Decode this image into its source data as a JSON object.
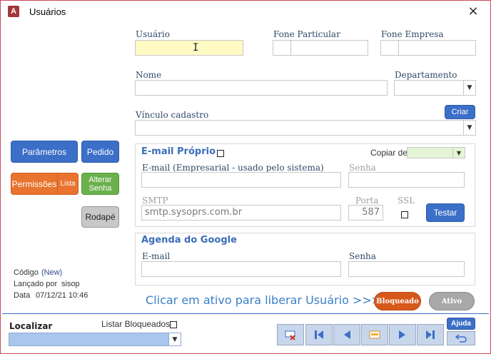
{
  "window": {
    "title": "Usuários",
    "close_icon": "×"
  },
  "fields": {
    "usuario_label": "Usuário",
    "fone_particular_label": "Fone Particular",
    "fone_empresa_label": "Fone Empresa",
    "nome_label": "Nome",
    "departamento_label": "Departamento",
    "vinculo_label": "Vínculo cadastro",
    "criar_label": "Criar"
  },
  "email_proprio": {
    "title": "E-mail Próprio",
    "copiar_de_label": "Copiar de",
    "email_label": "E-mail (Empresarial - usado pelo sistema)",
    "senha_label": "Senha",
    "smtp_label": "SMTP",
    "smtp_value": "smtp.sysoprs.com.br",
    "porta_label": "Porta",
    "porta_value": "587",
    "ssl_label": "SSL",
    "testar_label": "Testar"
  },
  "agenda_google": {
    "title": "Agenda do Google",
    "email_label": "E-mail",
    "senha_label": "Senha"
  },
  "left_buttons": {
    "parametros": "Parâmetros",
    "pedido": "Pedido",
    "permissoes": "Permissões",
    "lista": "Lista",
    "alterar_senha_1": "Alterar",
    "alterar_senha_2": "Senha",
    "rodape": "Rodapé"
  },
  "record_info": {
    "codigo_label": "Código",
    "codigo_value": "(New)",
    "lancado_label": "Lançado por",
    "lancado_value": "sisop",
    "data_label": "Data",
    "data_value": "07/12/21 10:46"
  },
  "status": {
    "hint": "Clicar em ativo para liberar Usuário >>>",
    "bloqueado": "Bloqueado",
    "ativo": "Ativo"
  },
  "footer": {
    "localizar_label": "Localizar",
    "listar_bloqueados_label": "Listar Bloqueados",
    "ajuda_label": "Ajuda"
  },
  "colors": {
    "accent": "#3c6fc8",
    "orange": "#e8742f",
    "green": "#6ab04c",
    "usuario_bg": "#fff9c4",
    "copiar_bg": "#e4f5d6"
  }
}
